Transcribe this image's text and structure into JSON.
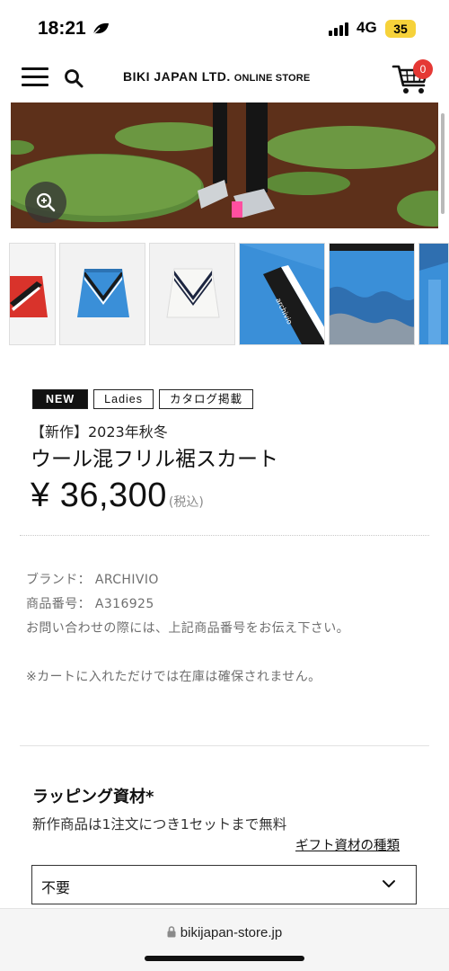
{
  "status_bar": {
    "time": "18:21",
    "network": "4G",
    "battery": "35"
  },
  "header": {
    "store_name": "BIKI JAPAN LTD.",
    "store_sub": "ONLINE STORE",
    "cart_count": "0"
  },
  "product": {
    "tags": [
      "NEW",
      "Ladies",
      "カタログ掲載"
    ],
    "subtitle": "【新作】2023年秋冬",
    "name": "ウール混フリル裾スカート",
    "price": "¥ 36,300",
    "tax_note": "(税込)"
  },
  "details": {
    "brand_line": "ブランド： ARCHIVIO",
    "code_line": "商品番号： A316925",
    "inquiry_note": "お問い合わせの際には、上記商品番号をお伝え下さい。",
    "stock_note": "※カートに入れただけでは在庫は確保されません。"
  },
  "wrapping": {
    "title": "ラッピング資材*",
    "description": "新作商品は1注文につき1セットまで無料",
    "link": "ギフト資材の種類",
    "selected": "不要"
  },
  "browser": {
    "url": "bikijapan-store.jp"
  },
  "icons": [
    "leaf-icon",
    "signal-icon",
    "menu-icon",
    "search-icon",
    "cart-icon",
    "zoom-icon",
    "lock-icon",
    "chevron-down-icon"
  ],
  "colors": {
    "cart_badge": "#e53935",
    "battery": "#f6d23a",
    "skirt_blue": "#3a8fd8",
    "skirt_red": "#d9332b"
  }
}
